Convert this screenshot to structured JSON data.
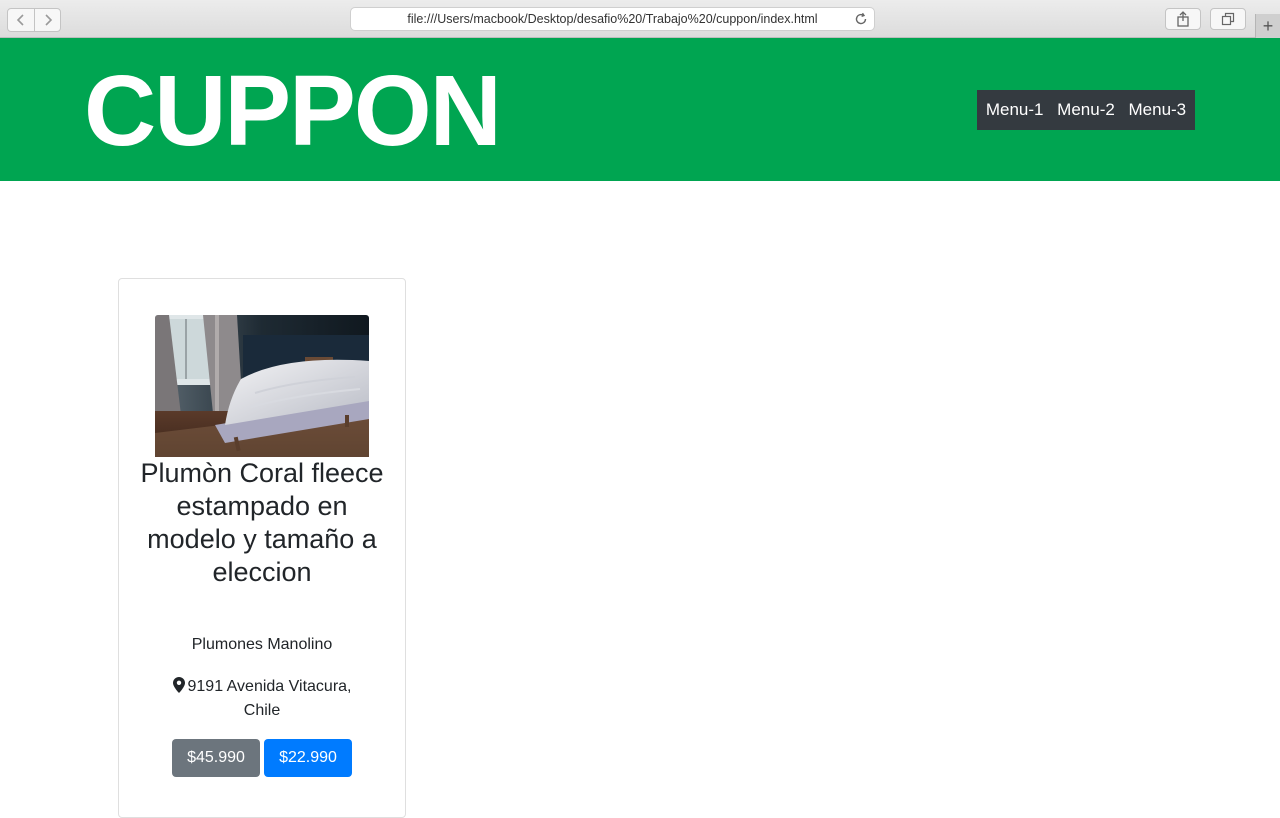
{
  "browser": {
    "url": "file:///Users/macbook/Desktop/desafio%20/Trabajo%20/cuppon/index.html",
    "new_tab_label": "+"
  },
  "header": {
    "logo": "CUPPON",
    "background_color": "#00a551",
    "menu": [
      {
        "label": "Menu-1"
      },
      {
        "label": "Menu-2"
      },
      {
        "label": "Menu-3"
      }
    ]
  },
  "product": {
    "image_icon": "bedroom-photo",
    "title": "Plumòn Coral fleece estampado en modelo y tamaño a eleccion",
    "vendor": "Plumones Manolino",
    "location_icon": "map-marker-icon",
    "address": "9191 Avenida Vitacura, Chile",
    "old_price": "$45.990",
    "new_price": "$22.990",
    "old_price_color": "#6c757d",
    "new_price_color": "#007bff"
  }
}
